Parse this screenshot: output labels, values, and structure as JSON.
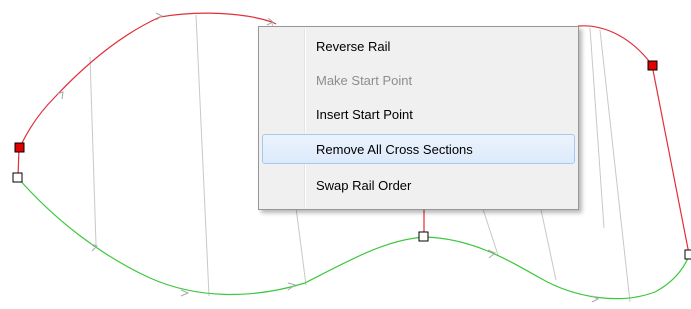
{
  "context_menu": {
    "items": [
      {
        "label": "Reverse Rail",
        "enabled": true,
        "highlighted": false
      },
      {
        "label": "Make Start Point",
        "enabled": false,
        "highlighted": false
      },
      {
        "label": "Insert Start Point",
        "enabled": true,
        "highlighted": false
      },
      {
        "label": "Remove All Cross Sections",
        "enabled": true,
        "highlighted": true
      },
      {
        "label": "Swap Rail Order",
        "enabled": true,
        "highlighted": false
      }
    ]
  },
  "colors": {
    "top_rail": "#e0303a",
    "bottom_rail": "#3cc83c",
    "cross_section": "#c8c8c8",
    "control_point_selected": "#e00000",
    "control_point": "#ffffff"
  }
}
